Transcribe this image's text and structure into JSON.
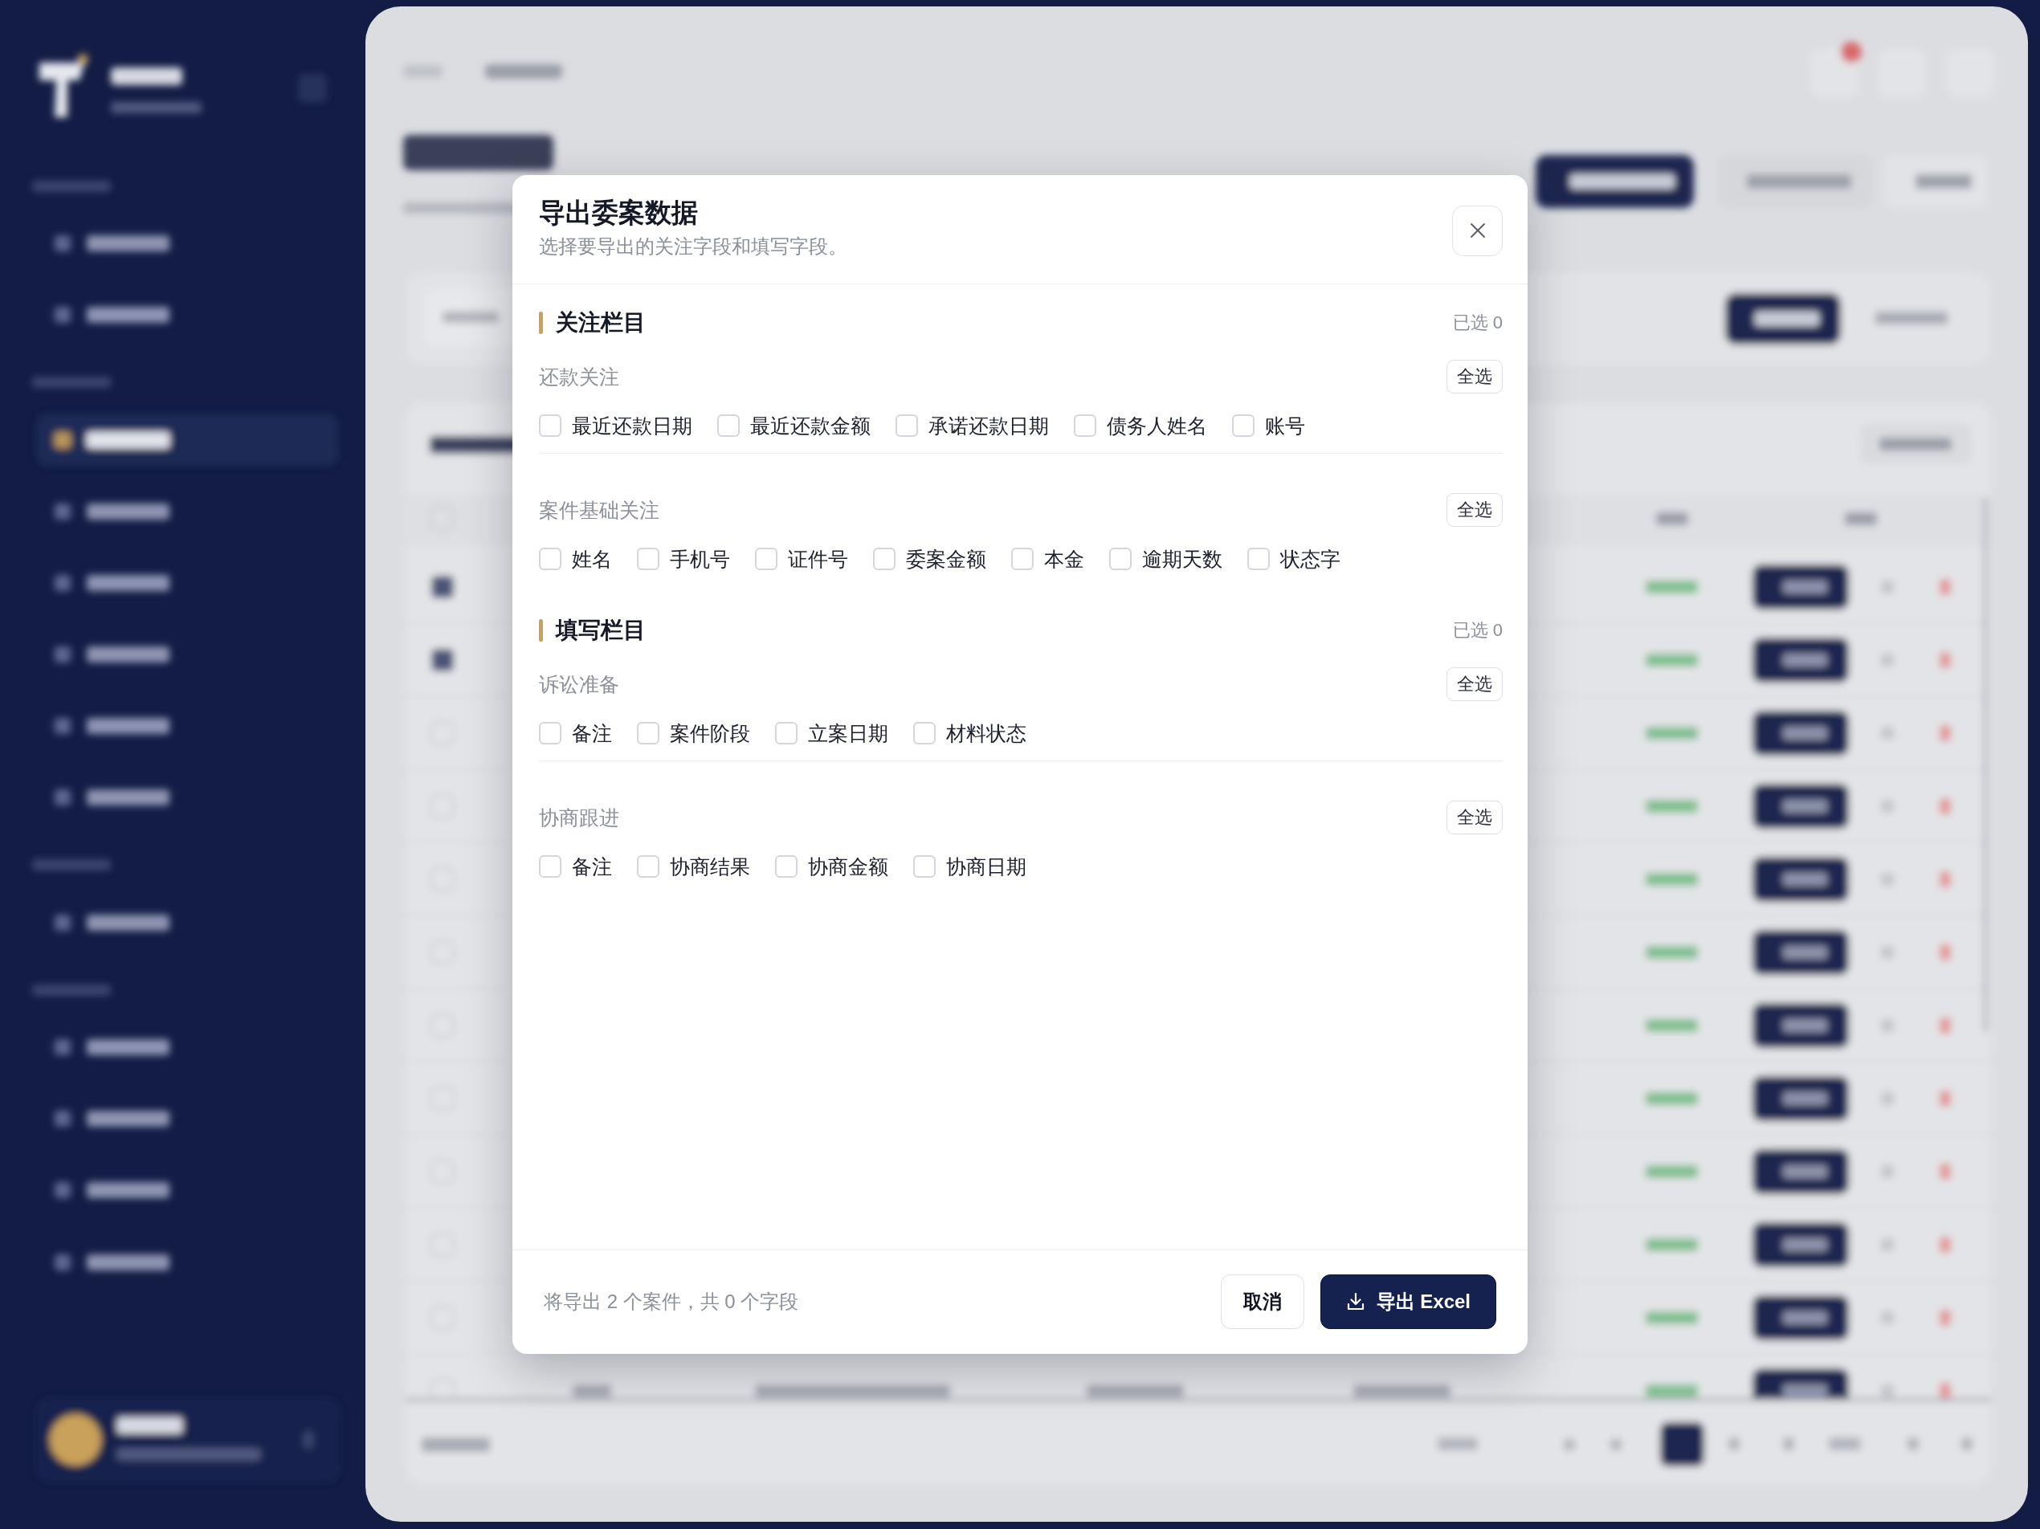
{
  "dialog": {
    "title": "导出委案数据",
    "subtitle": "选择要导出的关注字段和填写字段。",
    "sections": [
      {
        "title": "关注栏目",
        "count": "已选 0",
        "groups": [
          {
            "label": "还款关注",
            "select_all": "全选",
            "fields": [
              {
                "label": "最近还款日期",
                "checked": false
              },
              {
                "label": "最近还款金额",
                "checked": false
              },
              {
                "label": "承诺还款日期",
                "checked": false
              },
              {
                "label": "债务人姓名",
                "checked": false
              },
              {
                "label": "账号",
                "checked": false
              }
            ]
          },
          {
            "label": "案件基础关注",
            "select_all": "全选",
            "fields": [
              {
                "label": "姓名",
                "checked": false
              },
              {
                "label": "手机号",
                "checked": false
              },
              {
                "label": "证件号",
                "checked": false
              },
              {
                "label": "委案金额",
                "checked": false
              },
              {
                "label": "本金",
                "checked": false
              },
              {
                "label": "逾期天数",
                "checked": false
              },
              {
                "label": "状态字",
                "checked": false
              }
            ]
          }
        ]
      },
      {
        "title": "填写栏目",
        "count": "已选 0",
        "groups": [
          {
            "label": "诉讼准备",
            "select_all": "全选",
            "fields": [
              {
                "label": "备注",
                "checked": false
              },
              {
                "label": "案件阶段",
                "checked": false
              },
              {
                "label": "立案日期",
                "checked": false
              },
              {
                "label": "材料状态",
                "checked": false
              }
            ]
          },
          {
            "label": "协商跟进",
            "select_all": "全选",
            "fields": [
              {
                "label": "备注",
                "checked": false
              },
              {
                "label": "协商结果",
                "checked": false
              },
              {
                "label": "协商金额",
                "checked": false
              },
              {
                "label": "协商日期",
                "checked": false
              }
            ]
          }
        ]
      }
    ],
    "summary": "将导出 2 个案件，共 0 个字段",
    "buttons": [
      {
        "label": "取消",
        "kind": "secondary"
      },
      {
        "label": "导出 Excel",
        "kind": "primary"
      }
    ]
  }
}
